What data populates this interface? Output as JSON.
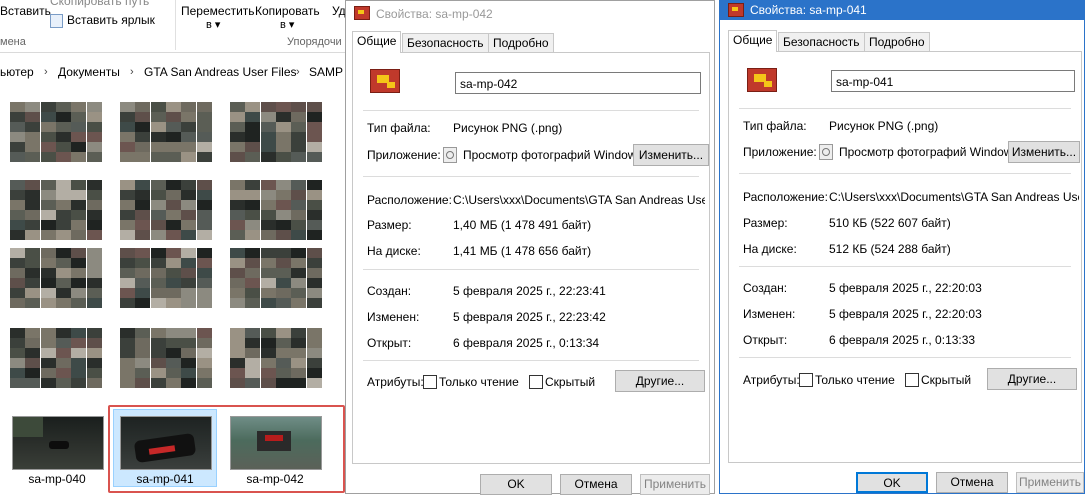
{
  "explorer": {
    "ribbon": {
      "paste": "Вставить",
      "copy_path": "Скопировать путь",
      "paste_shortcut": "Вставить ярлык",
      "move_to": "Переместить",
      "move_to_arrow": "в ▾",
      "copy_to": "Копировать",
      "copy_to_arrow": "в ▾",
      "delete_partial": "Уд",
      "group_clipboard": "мена",
      "group_organize": "Упорядочи"
    },
    "breadcrumb": [
      "ьютер",
      "Документы",
      "GTA San Andreas User Files",
      "SAMP"
    ],
    "files": [
      {
        "name": "sa-mp-040"
      },
      {
        "name": "sa-mp-041"
      },
      {
        "name": "sa-mp-042"
      }
    ]
  },
  "dialogs": [
    {
      "title": "Свойства: sa-mp-042",
      "tabs": [
        "Общие",
        "Безопасность",
        "Подробно"
      ],
      "filename": "sa-mp-042",
      "type_label": "Тип файла:",
      "type_value": "Рисунок PNG (.png)",
      "app_label": "Приложение:",
      "app_value": "Просмотр фотографий Windows",
      "change_button": "Изменить...",
      "location_label": "Расположение:",
      "location_value": "C:\\Users\\xxx\\Documents\\GTA San Andreas User Fil",
      "size_label": "Размер:",
      "size_value": "1,40 МБ (1 478 491 байт)",
      "disk_label": "На диске:",
      "disk_value": "1,41 МБ (1 478 656 байт)",
      "created_label": "Создан:",
      "created_value": "5 февраля 2025 г., 22:23:41",
      "modified_label": "Изменен:",
      "modified_value": "5 февраля 2025 г., 22:23:42",
      "opened_label": "Открыт:",
      "opened_value": "6 февраля 2025 г., 0:13:34",
      "attr_label": "Атрибуты:",
      "readonly_label": "Только чтение",
      "hidden_label": "Скрытый",
      "other_button": "Другие...",
      "ok": "OK",
      "cancel": "Отмена",
      "apply": "Применить"
    },
    {
      "title": "Свойства: sa-mp-041",
      "tabs": [
        "Общие",
        "Безопасность",
        "Подробно"
      ],
      "filename": "sa-mp-041",
      "type_label": "Тип файла:",
      "type_value": "Рисунок PNG (.png)",
      "app_label": "Приложение:",
      "app_value": "Просмотр фотографий Windows",
      "change_button": "Изменить...",
      "location_label": "Расположение:",
      "location_value": "C:\\Users\\xxx\\Documents\\GTA San Andreas User Fil",
      "size_label": "Размер:",
      "size_value": "510 КБ (522 607 байт)",
      "disk_label": "На диске:",
      "disk_value": "512 КБ (524 288 байт)",
      "created_label": "Создан:",
      "created_value": "5 февраля 2025 г., 22:20:03",
      "modified_label": "Изменен:",
      "modified_value": "5 февраля 2025 г., 22:20:03",
      "opened_label": "Открыт:",
      "opened_value": "6 февраля 2025 г., 0:13:33",
      "attr_label": "Атрибуты:",
      "readonly_label": "Только чтение",
      "hidden_label": "Скрытый",
      "other_button": "Другие...",
      "ok": "OK",
      "cancel": "Отмена",
      "apply": "Применить"
    }
  ],
  "colors": {
    "selection_outline": "#d9534f",
    "title_active": "#2b73c9",
    "selection_bg": "#cce8ff"
  }
}
